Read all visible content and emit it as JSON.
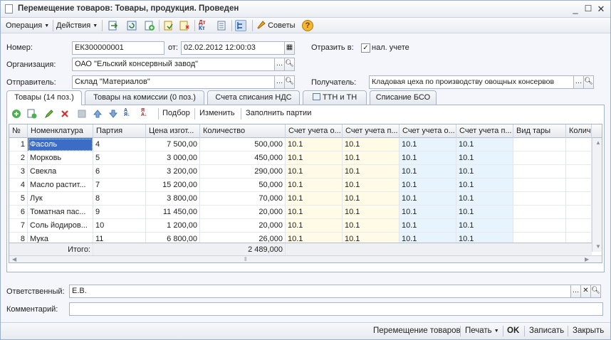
{
  "window": {
    "title": "Перемещение товаров: Товары, продукция. Проведен"
  },
  "toolbar": {
    "operation_label": "Операция",
    "actions_label": "Действия",
    "tips_label": "Советы"
  },
  "header": {
    "number_label": "Номер:",
    "number_value": "ЕК300000001",
    "date_label": "от:",
    "date_value": "02.02.2012 12:00:03",
    "reflect_label": "Отразить в:",
    "tax_accounting_label": "нал. учете",
    "organization_label": "Организация:",
    "organization_value": "ОАО \"Ельский консервный завод\"",
    "sender_label": "Отправитель:",
    "sender_value": "Склад \"Материалов\"",
    "receiver_label": "Получатель:",
    "receiver_value": "Кладовая цеха по производству овощных консервов"
  },
  "tabs": [
    {
      "label": "Товары (14 поз.)",
      "active": true
    },
    {
      "label": "Товары на комиссии (0 поз.)",
      "active": false
    },
    {
      "label": "Счета списания НДС",
      "active": false
    },
    {
      "label": "ТТН и ТН",
      "active": false
    },
    {
      "label": "Списание БСО",
      "active": false
    }
  ],
  "table_toolbar": {
    "select_label": "Подбор",
    "change_label": "Изменить",
    "fill_batches_label": "Заполнить партии"
  },
  "table": {
    "columns": [
      "№",
      "Номенклатура",
      "Партия",
      "Цена изгот...",
      "Количество",
      "Счет учета о...",
      "Счет учета п...",
      "Счет учета о...",
      "Счет учета п...",
      "Вид тары",
      "Колич"
    ],
    "rows": [
      [
        "1",
        "Фасоль",
        "4",
        "7 500,00",
        "500,000",
        "10.1",
        "10.1",
        "10.1",
        "10.1",
        "",
        ""
      ],
      [
        "2",
        "Морковь",
        "5",
        "3 000,00",
        "450,000",
        "10.1",
        "10.1",
        "10.1",
        "10.1",
        "",
        ""
      ],
      [
        "3",
        "Свекла",
        "6",
        "3 200,00",
        "290,000",
        "10.1",
        "10.1",
        "10.1",
        "10.1",
        "",
        ""
      ],
      [
        "4",
        "Масло растит...",
        "7",
        "15 200,00",
        "50,000",
        "10.1",
        "10.1",
        "10.1",
        "10.1",
        "",
        ""
      ],
      [
        "5",
        "Лук",
        "8",
        "3 800,00",
        "70,000",
        "10.1",
        "10.1",
        "10.1",
        "10.1",
        "",
        ""
      ],
      [
        "6",
        "Томатная пас...",
        "9",
        "11 450,00",
        "20,000",
        "10.1",
        "10.1",
        "10.1",
        "10.1",
        "",
        ""
      ],
      [
        "7",
        "Соль йодиров...",
        "10",
        "1 200,00",
        "20,000",
        "10.1",
        "10.1",
        "10.1",
        "10.1",
        "",
        ""
      ],
      [
        "8",
        "Мука",
        "11",
        "6 800,00",
        "26,000",
        "10.1",
        "10.1",
        "10.1",
        "10.1",
        "",
        ""
      ]
    ],
    "footer_label": "Итого:",
    "footer_total": "2 489,000"
  },
  "footer": {
    "responsible_label": "Ответственный:",
    "responsible_value": "Е.В.",
    "comment_label": "Комментарий:",
    "comment_value": ""
  },
  "bottom_bar": {
    "movement_label": "Перемещение товаров",
    "print_label": "Печать",
    "ok_label": "OK",
    "save_label": "Записать",
    "close_label": "Закрыть"
  },
  "colors": {
    "accent": "#3a6fbf",
    "selected_cell": "#3d6cc6",
    "yellow_col": "#fffbe6",
    "blue_col": "#e7f4fd"
  }
}
